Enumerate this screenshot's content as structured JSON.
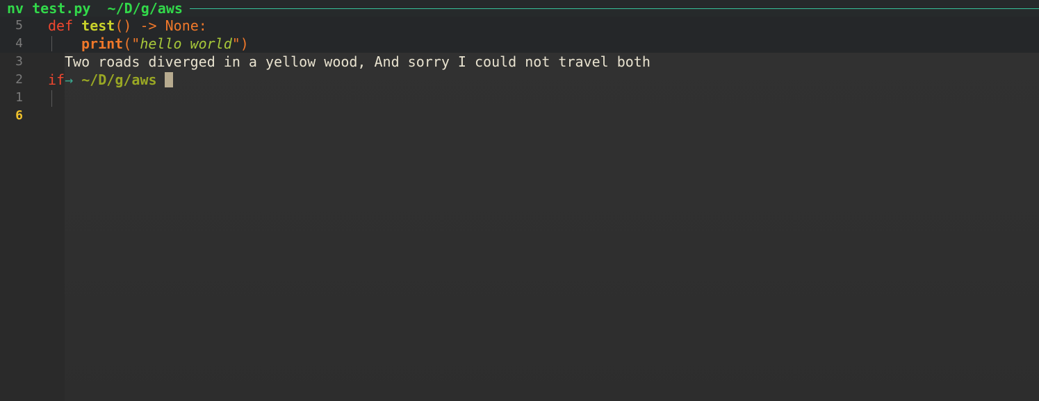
{
  "title": {
    "cmd": "nv",
    "file": "test.py",
    "path": "~/D/g/aws"
  },
  "gutter": {
    "line_numbers": [
      "5",
      "4",
      "3",
      "2",
      "1",
      "6"
    ]
  },
  "code": {
    "line5": {
      "kw": "def",
      "name": "test",
      "parens": "()",
      "arrow": " -> ",
      "ret": "None:"
    },
    "line4": {
      "fn": "print",
      "open": "(\"",
      "str": "hello world",
      "close": "\")"
    },
    "line3": {
      "text": "Two roads diverged in a yellow wood, And sorry I could not travel both"
    },
    "line2": {
      "kw": "if",
      "arrow": "→",
      "path": "~/D/g/aws"
    }
  },
  "colors": {
    "title": "#32d94a",
    "current_line_number": "#f0c22c",
    "keyword": "#f0472f",
    "function": "#c9d22b",
    "string": "#a8c93a"
  }
}
